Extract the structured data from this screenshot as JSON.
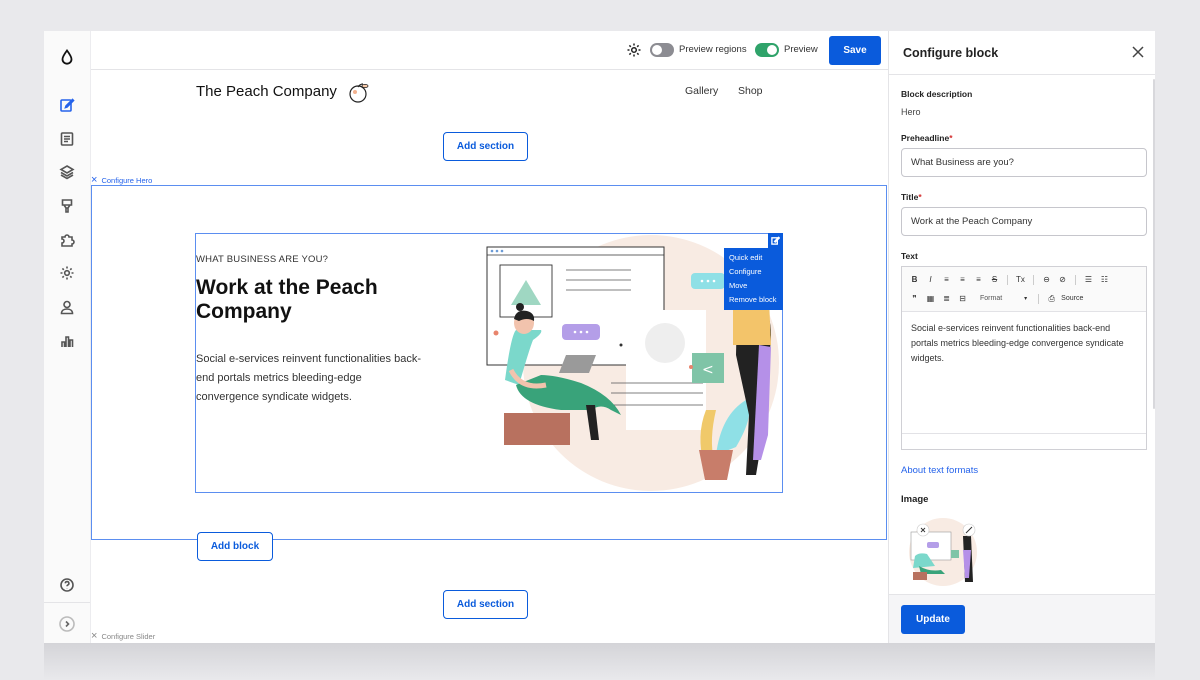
{
  "toolbar": {
    "settings_icon": "gear-icon",
    "preview_regions_label": "Preview regions",
    "preview_regions_on": false,
    "preview_label": "Preview",
    "preview_on": true,
    "save_label": "Save",
    "accent": "#0a5bdc"
  },
  "sidebar": {
    "logo_icon": "drop-icon",
    "items": [
      {
        "icon": "edit-icon",
        "active": true
      },
      {
        "icon": "document-icon"
      },
      {
        "icon": "layers-icon"
      },
      {
        "icon": "brush-icon"
      },
      {
        "icon": "puzzle-icon"
      },
      {
        "icon": "gear-icon"
      },
      {
        "icon": "user-icon"
      },
      {
        "icon": "bar-chart-icon"
      }
    ],
    "help_icon": "question-icon",
    "expand_icon": "chevron-right-icon"
  },
  "site": {
    "title": "The Peach Company",
    "nav": [
      "Gallery",
      "Shop"
    ]
  },
  "canvas": {
    "add_section_label": "Add section",
    "configure_hero_label": "Configure Hero",
    "configure_slider_label": "Configure Slider",
    "add_block_label": "Add block"
  },
  "hero": {
    "preheadline": "WHAT BUSINESS ARE YOU?",
    "title": "Work at the Peach Company",
    "text": "Social e-services reinvent functionalities back-end portals metrics bleeding-edge convergence syndicate widgets."
  },
  "quick_menu": [
    "Quick edit",
    "Configure",
    "Move",
    "Remove block"
  ],
  "panel": {
    "title": "Configure block",
    "block_description_label": "Block description",
    "block_description_value": "Hero",
    "preheadline_label": "Preheadline",
    "preheadline_value": "What Business are you?",
    "title_label": "Title",
    "title_value": "Work at the Peach Company",
    "text_label": "Text",
    "editor_tools_row1": [
      "B",
      "I",
      "≡",
      "≡",
      "≡",
      "S",
      "Tx",
      "⊖",
      "⊘",
      "☰",
      "☷"
    ],
    "editor_tools_row2": [
      "❞",
      "▦",
      "≣",
      "⊟",
      "Format",
      "▾",
      "⎙",
      "Source"
    ],
    "text_value": "Social e-services reinvent functionalities back-end portals metrics bleeding-edge convergence syndicate widgets.",
    "about_text_formats": "About text formats",
    "image_label": "Image",
    "update_label": "Update"
  }
}
